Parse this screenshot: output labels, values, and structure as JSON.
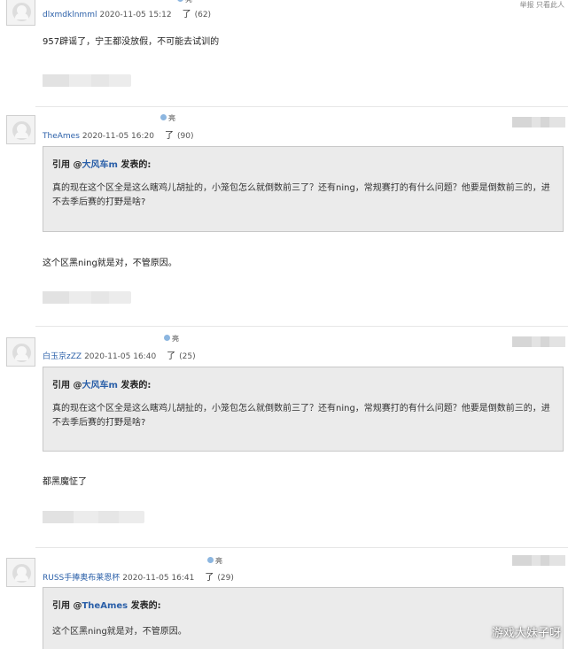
{
  "top_right_text": "举报 只看此人",
  "posts": [
    {
      "username": "dlxmdklnmml",
      "time": "2020-11-05 15:12",
      "liao": "了",
      "count": "(62)",
      "liang": "亮",
      "body": "957辟谣了，宁王都没放假，不可能去试训的"
    },
    {
      "username": "TheAmes",
      "time": "2020-11-05 16:20",
      "liao": "了",
      "count": "(90)",
      "liang": "亮",
      "quote": {
        "prefix": "引用 @",
        "author": "大风车m",
        "suffix": " 发表的:",
        "text": "真的现在这个区全是这么瞎鸡儿胡扯的，小笼包怎么就倒数前三了？还有ning，常规赛打的有什么问题？他要是倒数前三的，进不去季后赛的打野是啥?"
      },
      "body": "这个区黑ning就是对，不管原因。"
    },
    {
      "username": "白玉京zZZ",
      "time": "2020-11-05 16:40",
      "liao": "了",
      "count": "(25)",
      "liang": "亮",
      "quote": {
        "prefix": "引用 @",
        "author": "大风车m",
        "suffix": " 发表的:",
        "text": "真的现在这个区全是这么瞎鸡儿胡扯的，小笼包怎么就倒数前三了？还有ning，常规赛打的有什么问题？他要是倒数前三的，进不去季后赛的打野是啥?"
      },
      "body": "都黑魔怔了"
    },
    {
      "username": "RUSS手捧奥布莱恩杯",
      "time": "2020-11-05 16:41",
      "liao": "了",
      "count": "(29)",
      "liang": "亮",
      "quote": {
        "prefix": "引用 @",
        "author": "TheAmes",
        "suffix": " 发表的:",
        "text": "这个区黑ning就是对，不管原因。"
      }
    }
  ],
  "watermark": "游戏大妹子呀"
}
